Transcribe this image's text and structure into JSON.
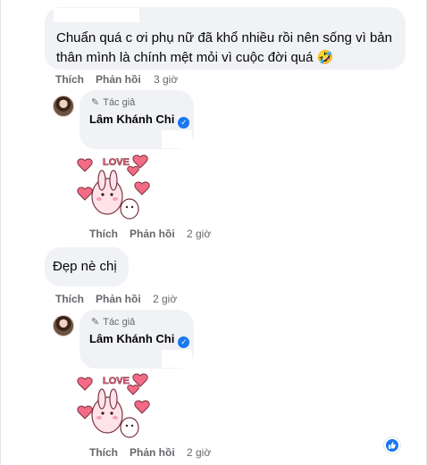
{
  "comments": [
    {
      "text": "Chuẩn quá c ơi phụ nữ đã khổ nhiều rồi nên sống vì bản thân mình là chính mệt mỏi vì cuộc đời quá 🤣",
      "actions": {
        "like": "Thích",
        "reply": "Phản hồi",
        "time": "3 giờ"
      }
    },
    {
      "text": "Đẹp nè chị",
      "actions": {
        "like": "Thích",
        "reply": "Phản hồi",
        "time": "2 giờ"
      }
    }
  ],
  "replies": [
    {
      "badge": "Tác giả",
      "author": "Lâm Khánh Chi",
      "sticker": {
        "icon": "love-bunny-sticker",
        "text": "LOVE"
      },
      "actions": {
        "like": "Thích",
        "reply": "Phản hồi",
        "time": "2 giờ"
      }
    },
    {
      "badge": "Tác giả",
      "author": "Lâm Khánh Chi",
      "sticker": {
        "icon": "love-bunny-sticker",
        "text": "LOVE"
      },
      "actions": {
        "like": "Thích",
        "reply": "Phản hồi",
        "time": "2 giờ"
      }
    }
  ],
  "reaction": {
    "icon": "thumbs-up-icon",
    "color": "#1877f2"
  }
}
